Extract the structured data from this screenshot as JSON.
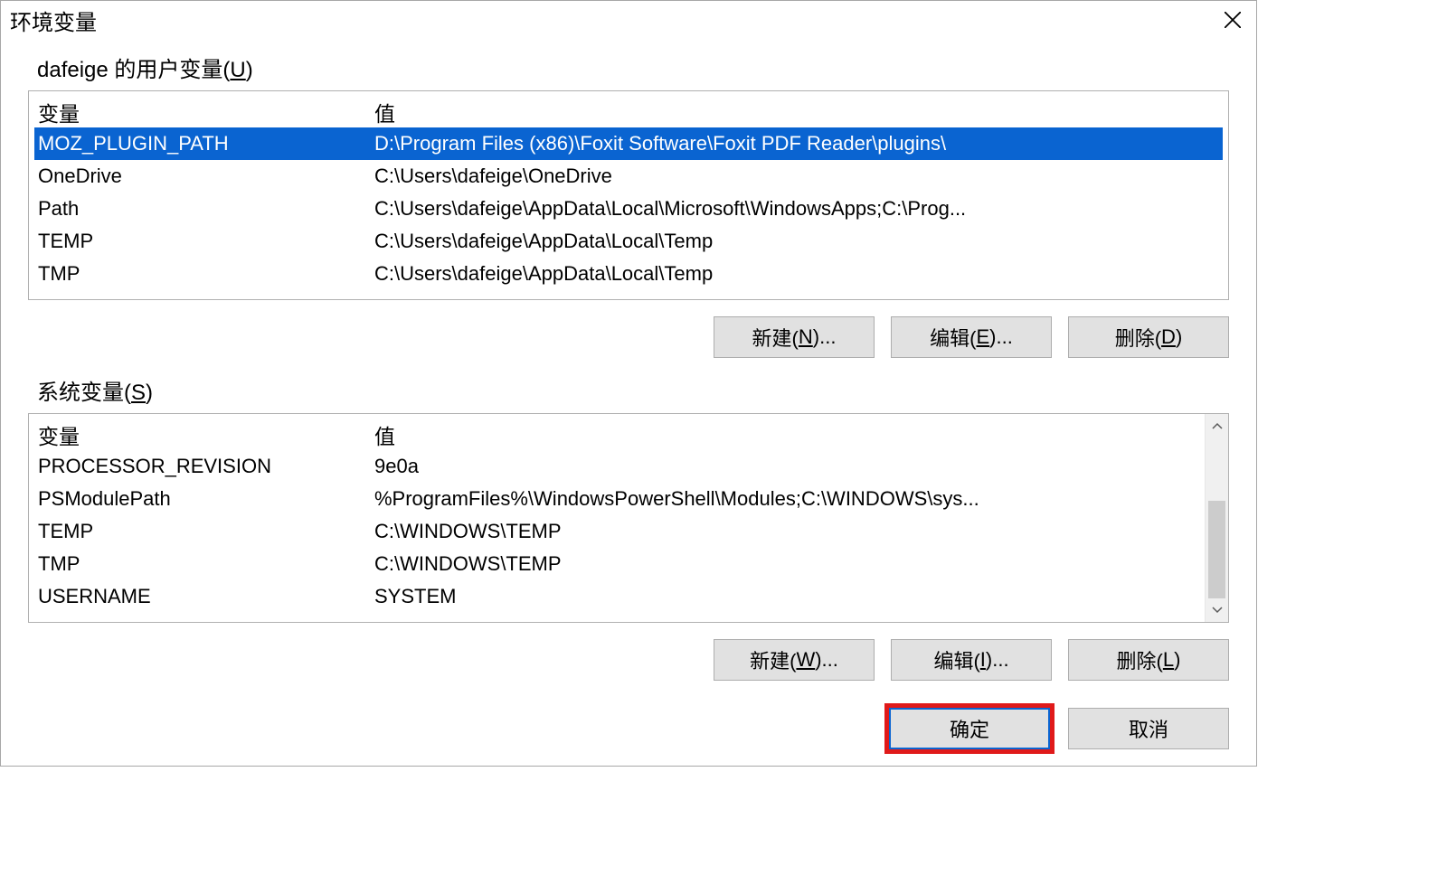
{
  "dialog": {
    "title": "环境变量"
  },
  "user": {
    "group_label_prefix": "dafeige 的用户变量(",
    "group_label_hotkey": "U",
    "group_label_suffix": ")",
    "header_var": "变量",
    "header_val": "值",
    "rows": [
      {
        "var": "MOZ_PLUGIN_PATH",
        "val": "D:\\Program Files (x86)\\Foxit Software\\Foxit PDF Reader\\plugins\\",
        "selected": true
      },
      {
        "var": "OneDrive",
        "val": "C:\\Users\\dafeige\\OneDrive",
        "selected": false
      },
      {
        "var": "Path",
        "val": "C:\\Users\\dafeige\\AppData\\Local\\Microsoft\\WindowsApps;C:\\Prog...",
        "selected": false
      },
      {
        "var": "TEMP",
        "val": "C:\\Users\\dafeige\\AppData\\Local\\Temp",
        "selected": false
      },
      {
        "var": "TMP",
        "val": "C:\\Users\\dafeige\\AppData\\Local\\Temp",
        "selected": false
      }
    ],
    "btn_new_prefix": "新建(",
    "btn_new_hotkey": "N",
    "btn_new_suffix": ")...",
    "btn_edit_prefix": "编辑(",
    "btn_edit_hotkey": "E",
    "btn_edit_suffix": ")...",
    "btn_delete_prefix": "删除(",
    "btn_delete_hotkey": "D",
    "btn_delete_suffix": ")"
  },
  "system": {
    "group_label_prefix": "系统变量(",
    "group_label_hotkey": "S",
    "group_label_suffix": ")",
    "header_var": "变量",
    "header_val": "值",
    "rows": [
      {
        "var": "PROCESSOR_REVISION",
        "val": "9e0a"
      },
      {
        "var": "PSModulePath",
        "val": "%ProgramFiles%\\WindowsPowerShell\\Modules;C:\\WINDOWS\\sys..."
      },
      {
        "var": "TEMP",
        "val": "C:\\WINDOWS\\TEMP"
      },
      {
        "var": "TMP",
        "val": "C:\\WINDOWS\\TEMP"
      },
      {
        "var": "USERNAME",
        "val": "SYSTEM"
      }
    ],
    "btn_new_prefix": "新建(",
    "btn_new_hotkey": "W",
    "btn_new_suffix": ")...",
    "btn_edit_prefix": "编辑(",
    "btn_edit_hotkey": "I",
    "btn_edit_suffix": ")...",
    "btn_delete_prefix": "删除(",
    "btn_delete_hotkey": "L",
    "btn_delete_suffix": ")"
  },
  "footer": {
    "ok": "确定",
    "cancel": "取消"
  }
}
